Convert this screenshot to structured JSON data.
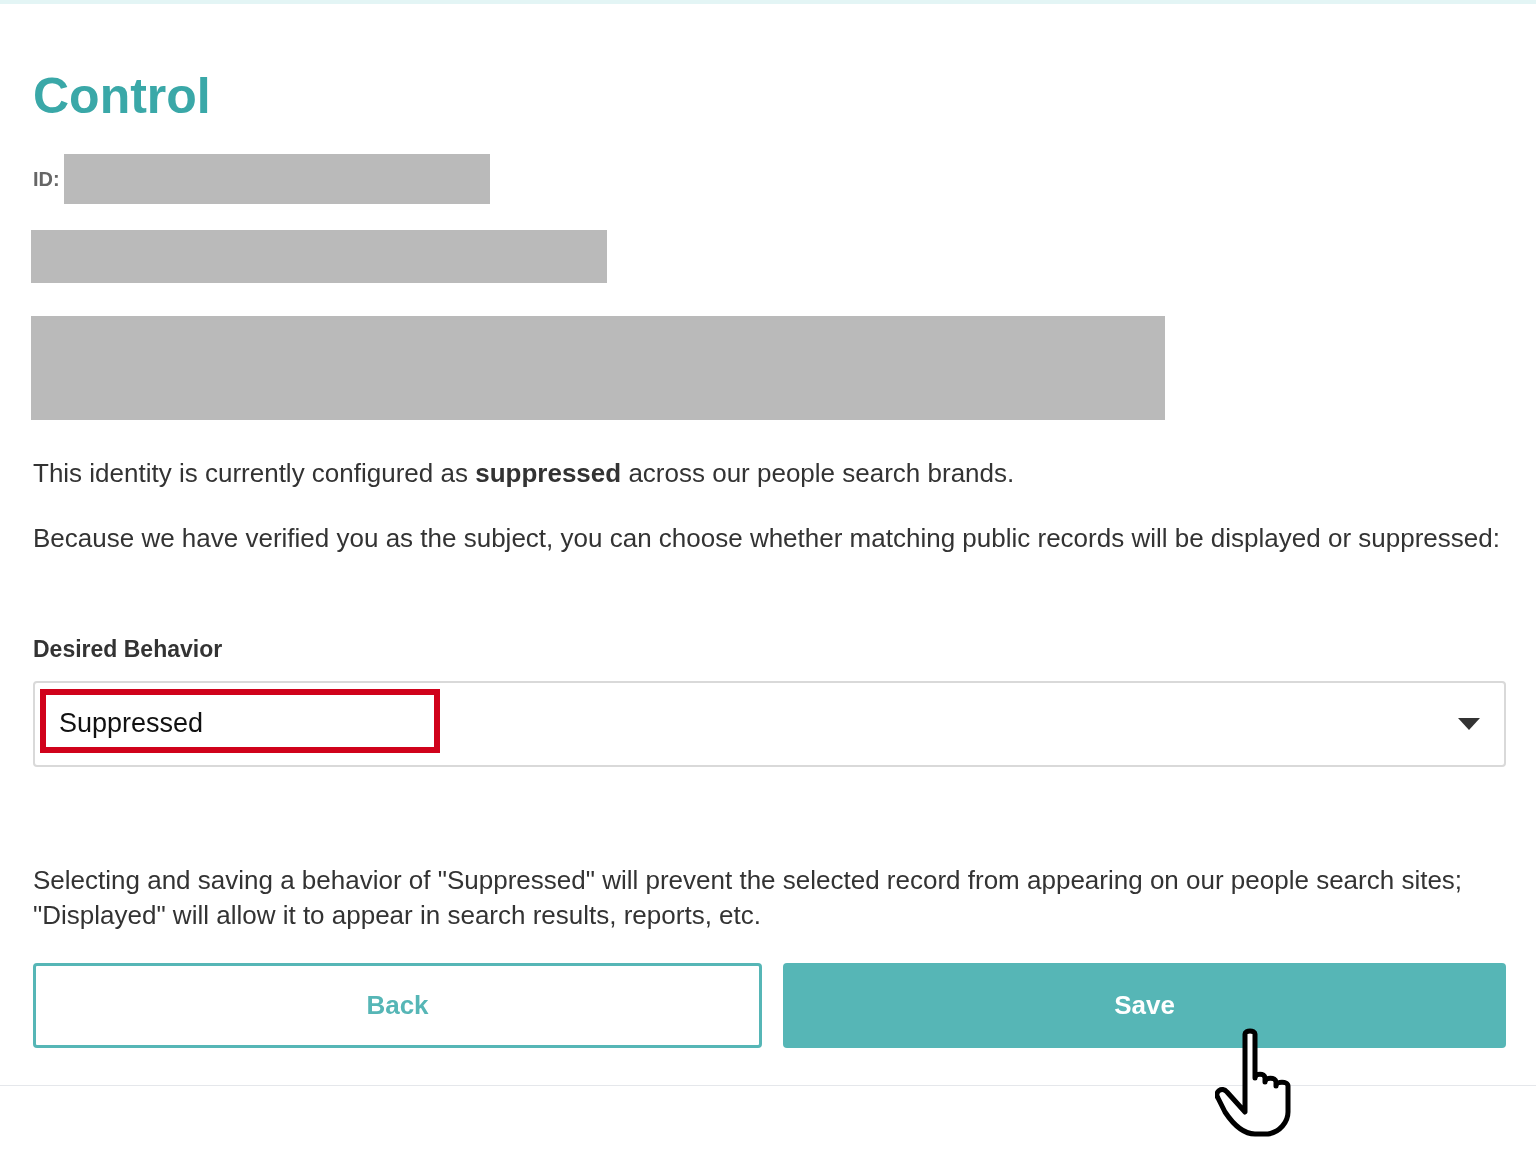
{
  "title": "Control",
  "id_label": "ID:",
  "status_text": "This identity is currently configured as **suppressed** across our people search brands.",
  "choice_text": "Because we have verified you as the subject, you can choose whether matching public records will be displayed or suppressed:",
  "field": {
    "label": "Desired Behavior",
    "value": "Suppressed",
    "highlighted": true
  },
  "help_text": "Selecting and saving a behavior of \"Suppressed\" will prevent the selected record from appearing on our people search sites; \"Displayed\" will allow it to appear in search results, reports, etc.",
  "buttons": [
    {
      "label": "Back",
      "kind": "outline"
    },
    {
      "label": "Save",
      "kind": "filled"
    }
  ]
}
